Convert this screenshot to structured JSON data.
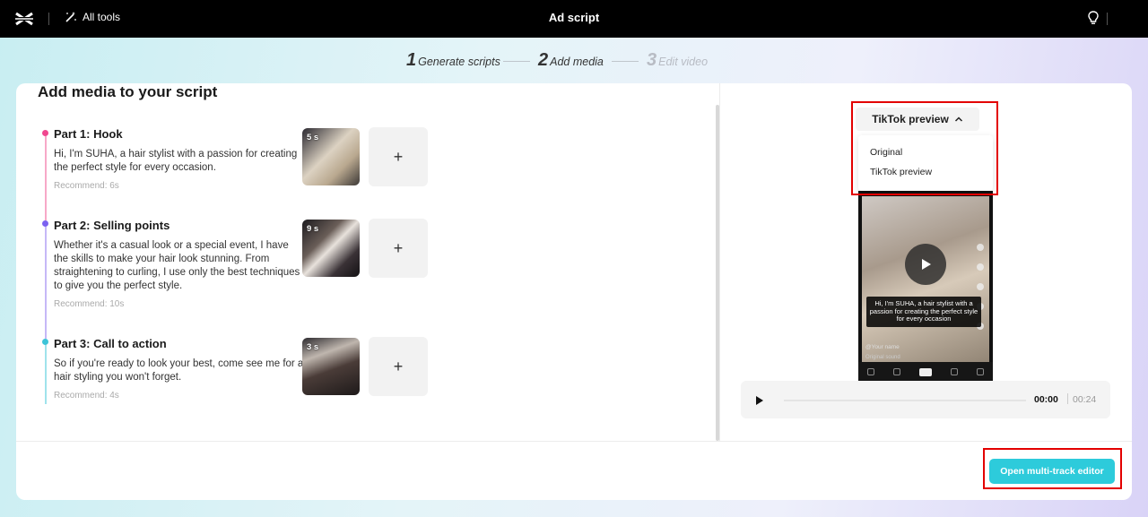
{
  "header": {
    "all_tools_label": "All tools",
    "title": "Ad script"
  },
  "stepper": {
    "steps": [
      {
        "number": "1",
        "label": "Generate scripts",
        "state": "done"
      },
      {
        "number": "2",
        "label": "Add media",
        "state": "active"
      },
      {
        "number": "3",
        "label": "Edit video",
        "state": "disabled"
      }
    ]
  },
  "main": {
    "title": "Add media to your script",
    "parts": [
      {
        "title": "Part 1: Hook",
        "description": "Hi, I'm SUHA, a hair stylist with a passion for creating the perfect style for every occasion.",
        "recommend": "Recommend: 6s",
        "media_duration": "5 s",
        "color": "#f0468f"
      },
      {
        "title": "Part 2: Selling points",
        "description": "Whether it's a casual look or a special event, I have the skills to make your hair look stunning. From straightening to curling, I use only the best techniques to give you the perfect style.",
        "recommend": "Recommend: 10s",
        "media_duration": "9 s",
        "color": "#7b61f0"
      },
      {
        "title": "Part 3: Call to action",
        "description": "So if you're ready to look your best, come see me for a hair styling you won't forget.",
        "recommend": "Recommend: 4s",
        "media_duration": "3 s",
        "color": "#3bc4d8"
      }
    ],
    "add_symbol": "+"
  },
  "preview": {
    "dropdown_selected": "TikTok preview",
    "dropdown_options": [
      "Original",
      "TikTok preview"
    ],
    "caption": "Hi, I'm SUHA, a hair stylist with a passion for creating the perfect style for every occasion",
    "username": "@Your name",
    "sound": "Original sound",
    "current_time": "00:00",
    "total_time": "00:24"
  },
  "footer": {
    "editor_button": "Open multi-track editor"
  },
  "colors": {
    "accent": "#2dcbdb",
    "highlight": "#e30000"
  }
}
